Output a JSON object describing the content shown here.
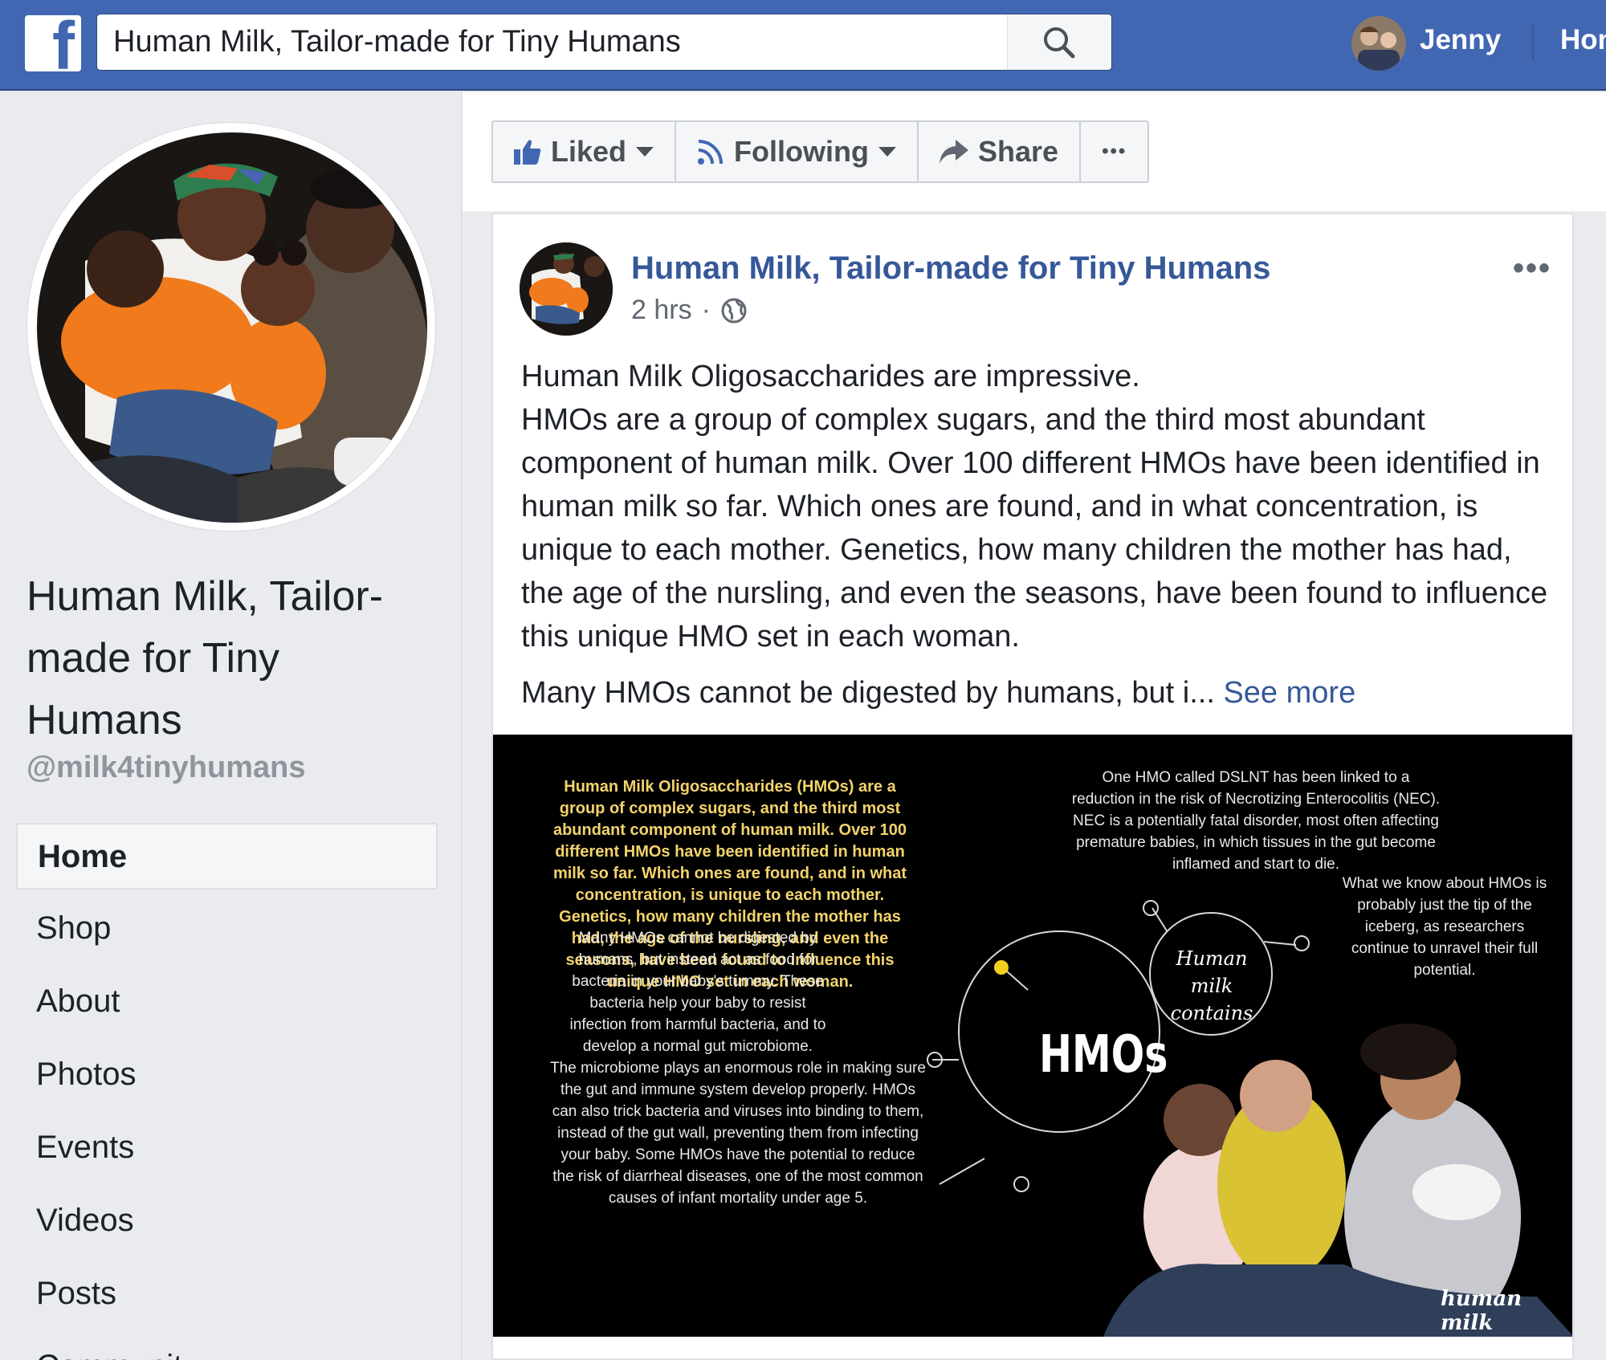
{
  "topbar": {
    "logo_letter": "f",
    "search_value": "Human Milk, Tailor-made for Tiny Humans",
    "user_name": "Jenny",
    "home_link": "Home"
  },
  "page": {
    "name": "Human Milk, Tailor-made for Tiny Humans",
    "handle": "@milk4tinyhumans"
  },
  "nav": {
    "items": [
      "Home",
      "Shop",
      "About",
      "Photos",
      "Events",
      "Videos",
      "Posts",
      "Community"
    ]
  },
  "actions": {
    "liked": "Liked",
    "following": "Following",
    "share": "Share",
    "more": "•••"
  },
  "post": {
    "author": "Human Milk, Tailor-made for Tiny Humans",
    "time": "2 hrs",
    "separator": "·",
    "more": "•••",
    "paragraph1": "Human Milk Oligosaccharides are impressive.\nHMOs are a group of complex sugars, and the third most abundant component of human milk. Over 100 different HMOs have been identified in human milk so far. Which ones are found, and in what concentration, is unique to each mother. Genetics, how many children the mother has had, the age of the nursling, and even the seasons, have been found to influence this unique HMO set in each woman.",
    "paragraph2": "Many HMOs cannot be digested by humans, but i...",
    "see_more": "See more"
  },
  "infographic": {
    "yellow_block": "Human Milk Oligosaccharides (HMOs) are a group of complex sugars, and the third most abundant component of human milk. Over 100 different HMOs have been identified in human milk so far. Which ones are found, and in what concentration, is unique to each mother. Genetics, how many children the mother has had, the age of the nursling, and even the seasons, have been found to influence this unique HMO set in each woman.",
    "digest_block": "Many HMOs cannot be digested by humans, but instead act as food for bacteria in your baby's tummy. These bacteria help your baby to resist infection from harmful bacteria, and to develop a normal gut microbiome.",
    "microbiome_block": "The microbiome plays an enormous role in making sure the gut and immune system develop properly. HMOs can also trick bacteria and viruses into binding to them, instead of the gut wall, preventing them from infecting your baby. Some HMOs have the potential to reduce the risk of diarrheal diseases, one of the most common causes of infant mortality under age 5.",
    "dslnt_block": "One HMO called DSLNT has been linked to a reduction in the risk of Necrotizing Enterocolitis (NEC). NEC is a potentially fatal disorder, most often affecting premature babies, in which tissues in the gut become inflamed and start to die.",
    "iceberg_block": "What we know about HMOs is probably just the tip of the iceberg, as researchers continue to unravel their full potential.",
    "bubble_line1": "Human",
    "bubble_line2": "milk",
    "bubble_line3": "contains",
    "big_label": "HMOs",
    "brand": "human milk"
  },
  "colors": {
    "fb_blue": "#4267b2",
    "link_blue": "#365899",
    "infographic_yellow": "#f2d36b",
    "accent_dot": "#f5d020"
  }
}
